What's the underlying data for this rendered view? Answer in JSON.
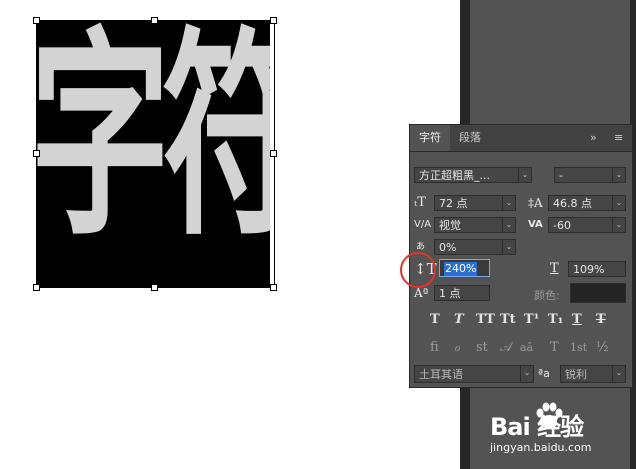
{
  "canvas": {
    "glyph_1": "字",
    "glyph_2": "符"
  },
  "panel": {
    "tabs": [
      "字符",
      "段落"
    ],
    "menu_collapse": "»",
    "menu_icon": "≡",
    "font_family": "方正超粗黑_...",
    "font_style": "-",
    "font_size": "72 点",
    "leading": "46.8 点",
    "kerning": "视觉",
    "tracking": "-60",
    "tsume": "0%",
    "vertical_scale": "240%",
    "horizontal_scale": "109%",
    "baseline_shift": "1 点",
    "color_label": "颜色:",
    "style_buttons": [
      "T",
      "T",
      "TT",
      "Tt",
      "T¹",
      "T₁",
      "T",
      "T"
    ],
    "opentype_buttons": [
      "fi",
      "ℴ",
      "st",
      "𝒜",
      "aā",
      "T",
      "1st",
      "½"
    ],
    "language": "土耳其语",
    "aa_icon": "ªa",
    "antialias": "锐利",
    "colors": {
      "field": "#454545",
      "selection": "#2b6fd1",
      "highlight_circle": "#e4322b"
    }
  },
  "watermark": {
    "brand": "Bai 经验",
    "url": "jingyan.baidu.com"
  }
}
